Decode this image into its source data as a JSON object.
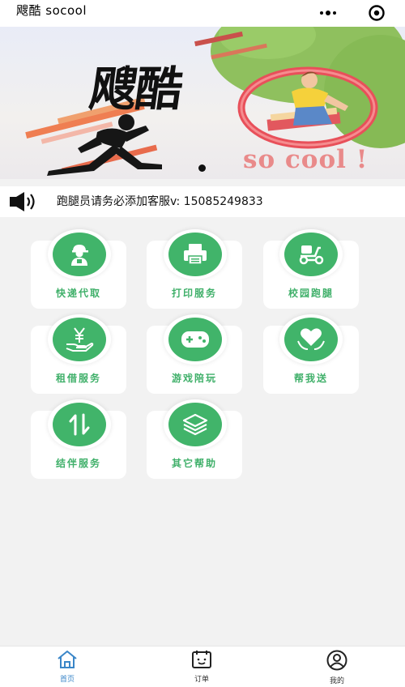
{
  "header": {
    "title": "飕酷 socool",
    "more_icon": "more-dots-icon",
    "close_icon": "target-close-icon"
  },
  "banner": {
    "title": "飕酷",
    "subtitle": "so cool !",
    "slides_active": 1
  },
  "notice": {
    "icon": "speaker-icon",
    "text": "跑腿员请务必添加客服v: 15085249833"
  },
  "services": [
    {
      "label": "快递代取",
      "icon": "courier-person-icon"
    },
    {
      "label": "打印服务",
      "icon": "printer-icon"
    },
    {
      "label": "校园跑腿",
      "icon": "scooter-icon"
    },
    {
      "label": "租借服务",
      "icon": "yen-hand-icon"
    },
    {
      "label": "游戏陪玩",
      "icon": "gamepad-icon"
    },
    {
      "label": "帮我送",
      "icon": "heart-hands-icon"
    },
    {
      "label": "结伴服务",
      "icon": "swap-arrows-icon"
    },
    {
      "label": "其它帮助",
      "icon": "layers-icon"
    }
  ],
  "tabbar": {
    "active": "home",
    "items": [
      {
        "key": "home",
        "label": "首页",
        "icon": "home-icon"
      },
      {
        "key": "orders",
        "label": "订单",
        "icon": "order-list-icon"
      },
      {
        "key": "mine",
        "label": "我的",
        "icon": "user-icon"
      }
    ]
  },
  "colors": {
    "accent": "#41b46a",
    "tab_active": "#3a86c8",
    "tab_inactive": "#333333",
    "page_bg": "#f2f2f2"
  }
}
